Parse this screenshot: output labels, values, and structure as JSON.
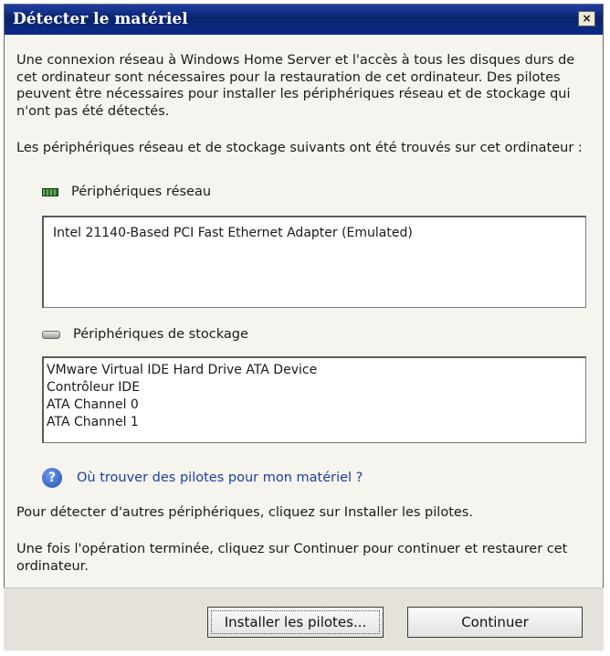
{
  "window": {
    "title": "Détecter le matériel",
    "close_glyph": "×"
  },
  "intro": {
    "paragraph1": "Une connexion réseau à Windows Home Server et l'accès à tous les disques durs de cet ordinateur sont nécessaires pour la restauration de cet ordinateur. Des pilotes peuvent être nécessaires pour installer les périphériques réseau et de stockage qui n'ont pas été détectés.",
    "paragraph2": "Les périphériques réseau et de stockage suivants ont été trouvés sur cet ordinateur :"
  },
  "network": {
    "icon": "network-card-icon",
    "label": "Périphériques réseau",
    "items": [
      "Intel 21140-Based PCI Fast Ethernet Adapter (Emulated)"
    ]
  },
  "storage": {
    "icon": "hard-drive-icon",
    "label": "Périphériques de stockage",
    "items": [
      "VMware Virtual IDE Hard Drive ATA Device",
      "Contrôleur IDE",
      "ATA Channel 0",
      "ATA Channel 1"
    ]
  },
  "help": {
    "icon": "help-icon",
    "glyph": "?",
    "link": "Où trouver des pilotes pour mon matériel ?"
  },
  "instructions": {
    "detect": "Pour détecter d'autres périphériques, cliquez sur Installer les pilotes.",
    "finish": "Une fois l'opération terminée, cliquez sur Continuer pour continuer et restaurer cet ordinateur."
  },
  "buttons": {
    "install": "Installer les pilotes...",
    "continue": "Continuer"
  }
}
